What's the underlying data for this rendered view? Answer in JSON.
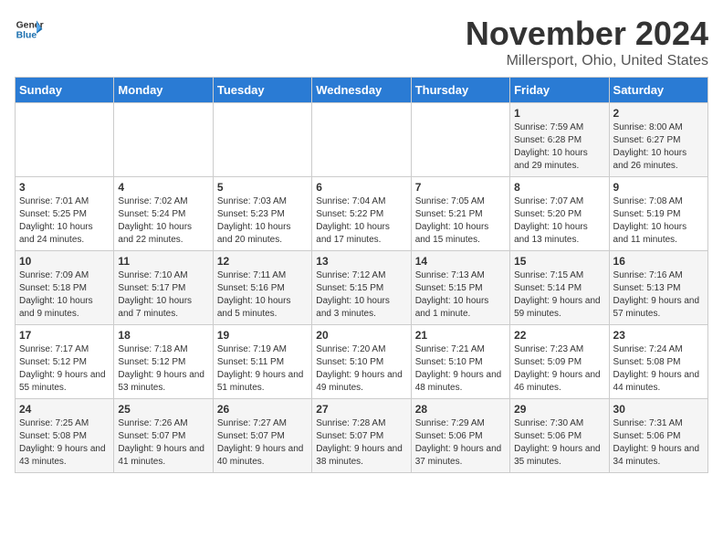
{
  "logo": {
    "general": "General",
    "blue": "Blue"
  },
  "header": {
    "month": "November 2024",
    "location": "Millersport, Ohio, United States"
  },
  "days_of_week": [
    "Sunday",
    "Monday",
    "Tuesday",
    "Wednesday",
    "Thursday",
    "Friday",
    "Saturday"
  ],
  "weeks": [
    [
      {
        "day": "",
        "info": ""
      },
      {
        "day": "",
        "info": ""
      },
      {
        "day": "",
        "info": ""
      },
      {
        "day": "",
        "info": ""
      },
      {
        "day": "",
        "info": ""
      },
      {
        "day": "1",
        "info": "Sunrise: 7:59 AM\nSunset: 6:28 PM\nDaylight: 10 hours and 29 minutes."
      },
      {
        "day": "2",
        "info": "Sunrise: 8:00 AM\nSunset: 6:27 PM\nDaylight: 10 hours and 26 minutes."
      }
    ],
    [
      {
        "day": "3",
        "info": "Sunrise: 7:01 AM\nSunset: 5:25 PM\nDaylight: 10 hours and 24 minutes."
      },
      {
        "day": "4",
        "info": "Sunrise: 7:02 AM\nSunset: 5:24 PM\nDaylight: 10 hours and 22 minutes."
      },
      {
        "day": "5",
        "info": "Sunrise: 7:03 AM\nSunset: 5:23 PM\nDaylight: 10 hours and 20 minutes."
      },
      {
        "day": "6",
        "info": "Sunrise: 7:04 AM\nSunset: 5:22 PM\nDaylight: 10 hours and 17 minutes."
      },
      {
        "day": "7",
        "info": "Sunrise: 7:05 AM\nSunset: 5:21 PM\nDaylight: 10 hours and 15 minutes."
      },
      {
        "day": "8",
        "info": "Sunrise: 7:07 AM\nSunset: 5:20 PM\nDaylight: 10 hours and 13 minutes."
      },
      {
        "day": "9",
        "info": "Sunrise: 7:08 AM\nSunset: 5:19 PM\nDaylight: 10 hours and 11 minutes."
      }
    ],
    [
      {
        "day": "10",
        "info": "Sunrise: 7:09 AM\nSunset: 5:18 PM\nDaylight: 10 hours and 9 minutes."
      },
      {
        "day": "11",
        "info": "Sunrise: 7:10 AM\nSunset: 5:17 PM\nDaylight: 10 hours and 7 minutes."
      },
      {
        "day": "12",
        "info": "Sunrise: 7:11 AM\nSunset: 5:16 PM\nDaylight: 10 hours and 5 minutes."
      },
      {
        "day": "13",
        "info": "Sunrise: 7:12 AM\nSunset: 5:15 PM\nDaylight: 10 hours and 3 minutes."
      },
      {
        "day": "14",
        "info": "Sunrise: 7:13 AM\nSunset: 5:15 PM\nDaylight: 10 hours and 1 minute."
      },
      {
        "day": "15",
        "info": "Sunrise: 7:15 AM\nSunset: 5:14 PM\nDaylight: 9 hours and 59 minutes."
      },
      {
        "day": "16",
        "info": "Sunrise: 7:16 AM\nSunset: 5:13 PM\nDaylight: 9 hours and 57 minutes."
      }
    ],
    [
      {
        "day": "17",
        "info": "Sunrise: 7:17 AM\nSunset: 5:12 PM\nDaylight: 9 hours and 55 minutes."
      },
      {
        "day": "18",
        "info": "Sunrise: 7:18 AM\nSunset: 5:12 PM\nDaylight: 9 hours and 53 minutes."
      },
      {
        "day": "19",
        "info": "Sunrise: 7:19 AM\nSunset: 5:11 PM\nDaylight: 9 hours and 51 minutes."
      },
      {
        "day": "20",
        "info": "Sunrise: 7:20 AM\nSunset: 5:10 PM\nDaylight: 9 hours and 49 minutes."
      },
      {
        "day": "21",
        "info": "Sunrise: 7:21 AM\nSunset: 5:10 PM\nDaylight: 9 hours and 48 minutes."
      },
      {
        "day": "22",
        "info": "Sunrise: 7:23 AM\nSunset: 5:09 PM\nDaylight: 9 hours and 46 minutes."
      },
      {
        "day": "23",
        "info": "Sunrise: 7:24 AM\nSunset: 5:08 PM\nDaylight: 9 hours and 44 minutes."
      }
    ],
    [
      {
        "day": "24",
        "info": "Sunrise: 7:25 AM\nSunset: 5:08 PM\nDaylight: 9 hours and 43 minutes."
      },
      {
        "day": "25",
        "info": "Sunrise: 7:26 AM\nSunset: 5:07 PM\nDaylight: 9 hours and 41 minutes."
      },
      {
        "day": "26",
        "info": "Sunrise: 7:27 AM\nSunset: 5:07 PM\nDaylight: 9 hours and 40 minutes."
      },
      {
        "day": "27",
        "info": "Sunrise: 7:28 AM\nSunset: 5:07 PM\nDaylight: 9 hours and 38 minutes."
      },
      {
        "day": "28",
        "info": "Sunrise: 7:29 AM\nSunset: 5:06 PM\nDaylight: 9 hours and 37 minutes."
      },
      {
        "day": "29",
        "info": "Sunrise: 7:30 AM\nSunset: 5:06 PM\nDaylight: 9 hours and 35 minutes."
      },
      {
        "day": "30",
        "info": "Sunrise: 7:31 AM\nSunset: 5:06 PM\nDaylight: 9 hours and 34 minutes."
      }
    ]
  ]
}
